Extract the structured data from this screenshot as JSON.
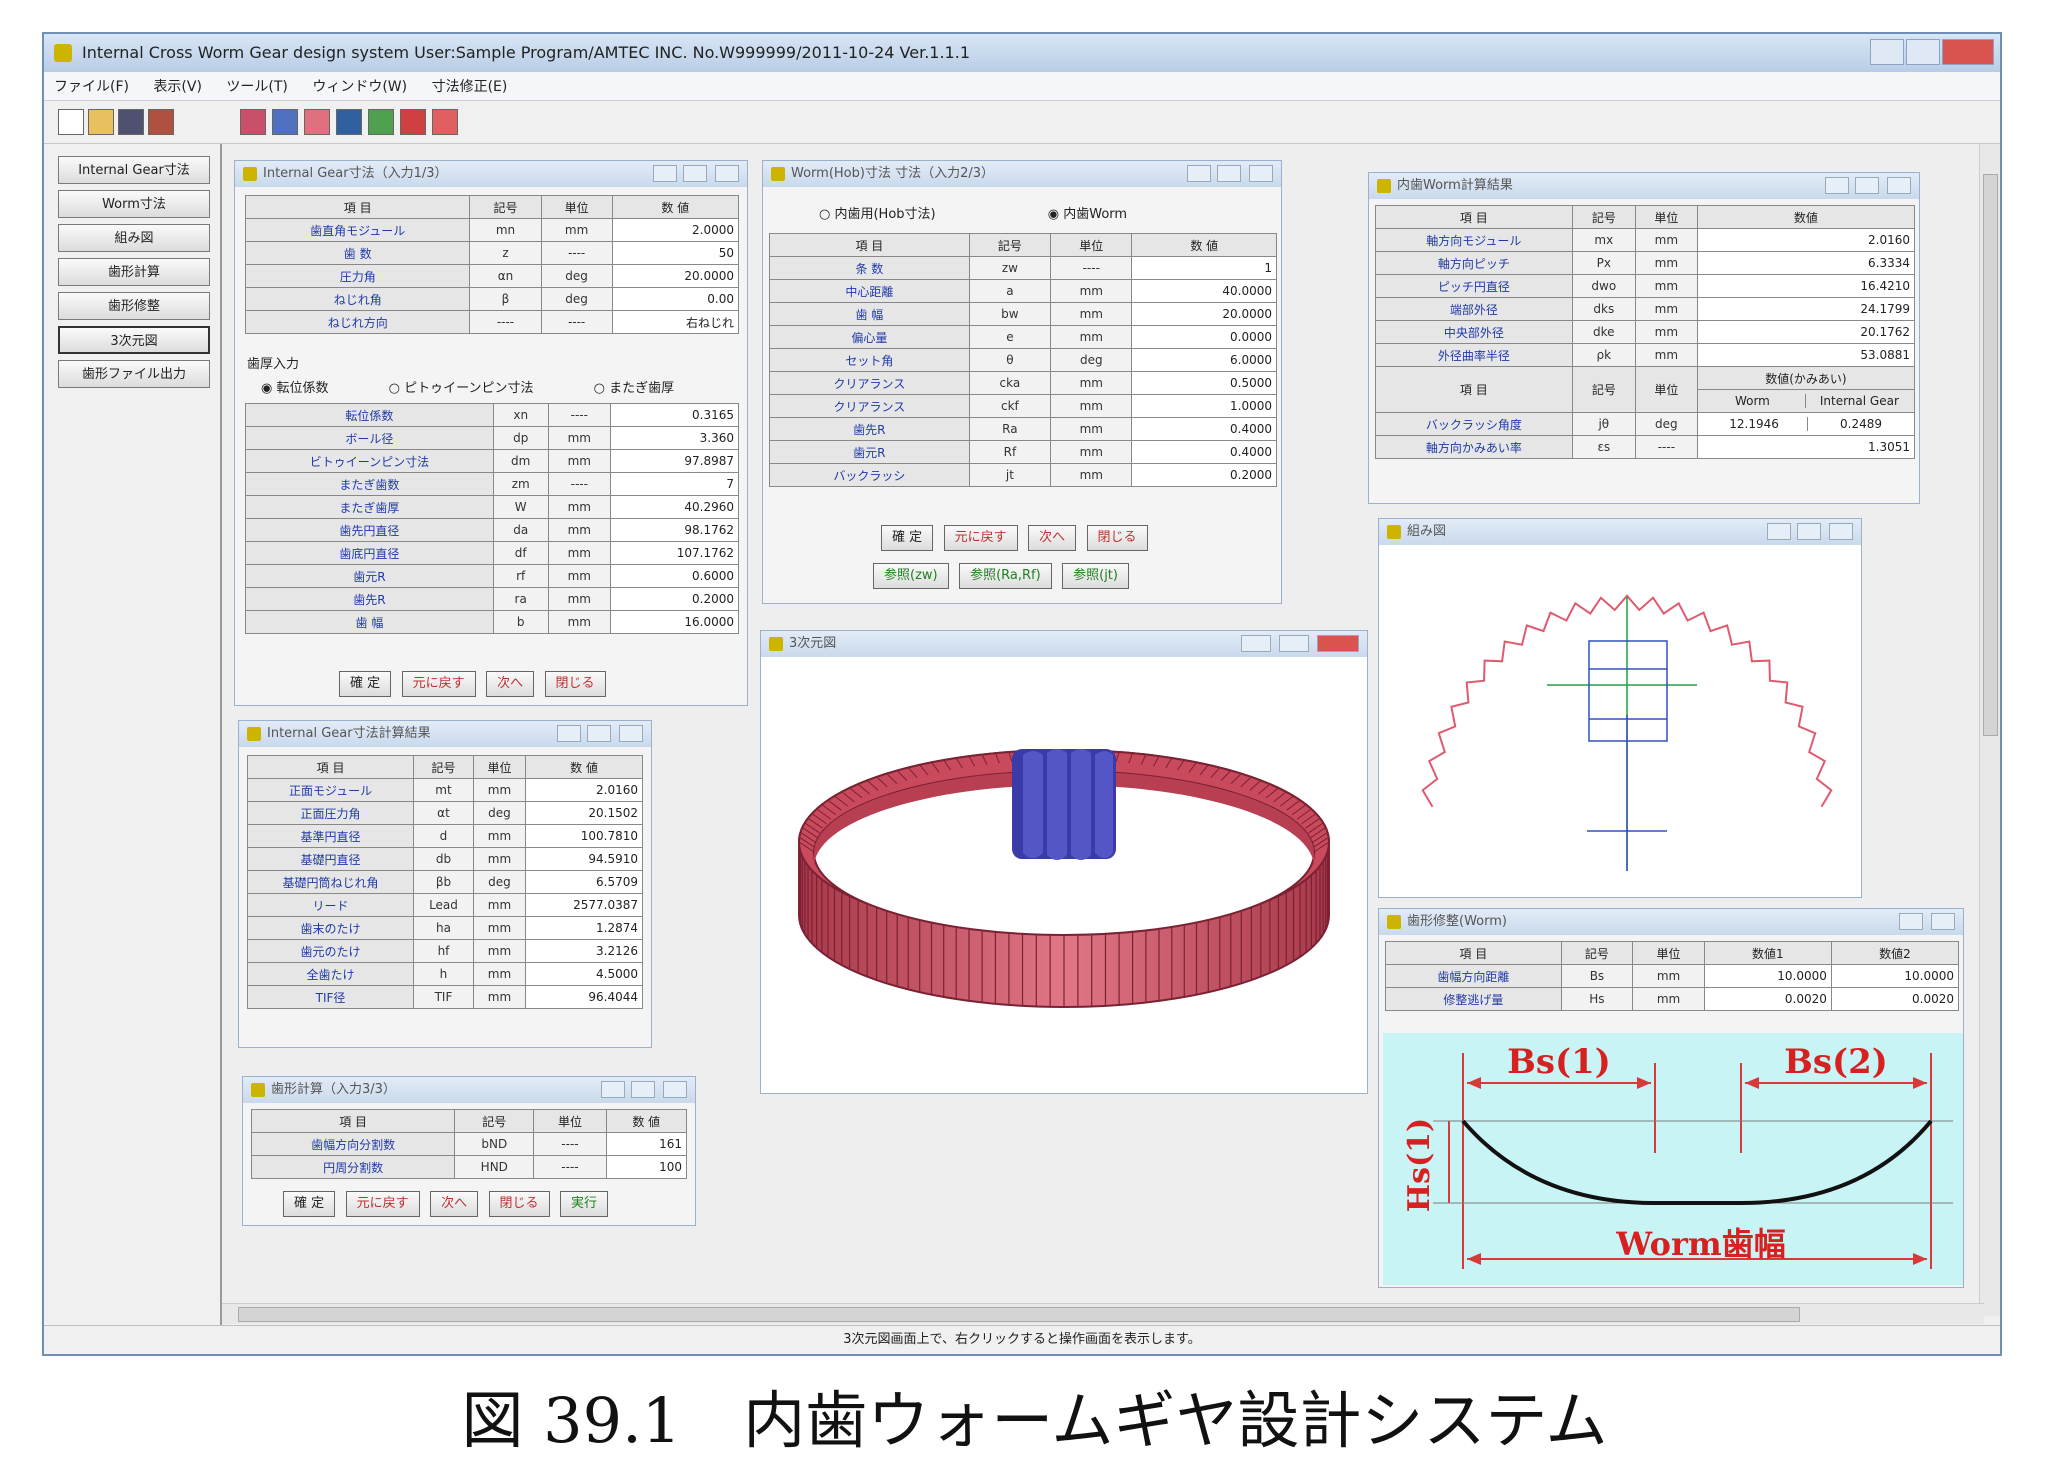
{
  "app": {
    "title": "Internal Cross Worm Gear design system   User:Sample Program/AMTEC INC.   No.W999999/2011-10-24   Ver.1.1.1",
    "menu": [
      "ファイル(F)",
      "表示(V)",
      "ツール(T)",
      "ウィンドウ(W)",
      "寸法修正(E)"
    ],
    "nav": [
      "Internal Gear寸法",
      "Worm寸法",
      "組み図",
      "歯形計算",
      "歯形修整",
      "3次元図",
      "歯形ファイル出力"
    ],
    "status": "3次元図画面上で、右クリックすると操作画面を表示します。"
  },
  "gear_input": {
    "title": "Internal Gear寸法（入力1/3）",
    "headers": [
      "項 目",
      "記号",
      "単位",
      "数 値"
    ],
    "rows": [
      {
        "label": "歯直角モジュール",
        "sym": "mn",
        "unit": "mm",
        "value": "2.0000"
      },
      {
        "label": "歯 数",
        "sym": "z",
        "unit": "----",
        "value": "50"
      },
      {
        "label": "圧力角",
        "sym": "αn",
        "unit": "deg",
        "value": "20.0000"
      },
      {
        "label": "ねじれ角",
        "sym": "β",
        "unit": "deg",
        "value": "0.00"
      },
      {
        "label": "ねじれ方向",
        "sym": "----",
        "unit": "----",
        "value": "右ねじれ"
      }
    ],
    "section": "歯厚入力",
    "radios": [
      "転位係数",
      "ピトゥイーンピン寸法",
      "またぎ歯厚"
    ],
    "rows2": [
      {
        "label": "転位係数",
        "sym": "xn",
        "unit": "----",
        "value": "0.3165"
      },
      {
        "label": "ボール径",
        "sym": "dp",
        "unit": "mm",
        "value": "3.360"
      },
      {
        "label": "ビトゥイーンピン寸法",
        "sym": "dm",
        "unit": "mm",
        "value": "97.8987"
      },
      {
        "label": "またぎ歯数",
        "sym": "zm",
        "unit": "----",
        "value": "7"
      },
      {
        "label": "またぎ歯厚",
        "sym": "W",
        "unit": "mm",
        "value": "40.2960"
      },
      {
        "label": "歯先円直径",
        "sym": "da",
        "unit": "mm",
        "value": "98.1762"
      },
      {
        "label": "歯底円直径",
        "sym": "df",
        "unit": "mm",
        "value": "107.1762"
      },
      {
        "label": "歯元R",
        "sym": "rf",
        "unit": "mm",
        "value": "0.6000"
      },
      {
        "label": "歯先R",
        "sym": "ra",
        "unit": "mm",
        "value": "0.2000"
      },
      {
        "label": "歯 幅",
        "sym": "b",
        "unit": "mm",
        "value": "16.0000"
      }
    ],
    "buttons": [
      "確 定",
      "元に戻す",
      "次へ",
      "閉じる"
    ]
  },
  "gear_result": {
    "title": "Internal Gear寸法計算結果",
    "headers": [
      "項 目",
      "記号",
      "単位",
      "数 値"
    ],
    "rows": [
      {
        "label": "正面モジュール",
        "sym": "mt",
        "unit": "mm",
        "value": "2.0160"
      },
      {
        "label": "正面圧力角",
        "sym": "αt",
        "unit": "deg",
        "value": "20.1502"
      },
      {
        "label": "基準円直径",
        "sym": "d",
        "unit": "mm",
        "value": "100.7810"
      },
      {
        "label": "基礎円直径",
        "sym": "db",
        "unit": "mm",
        "value": "94.5910"
      },
      {
        "label": "基礎円筒ねじれ角",
        "sym": "βb",
        "unit": "deg",
        "value": "6.5709"
      },
      {
        "label": "リード",
        "sym": "Lead",
        "unit": "mm",
        "value": "2577.0387"
      },
      {
        "label": "歯末のたけ",
        "sym": "ha",
        "unit": "mm",
        "value": "1.2874"
      },
      {
        "label": "歯元のたけ",
        "sym": "hf",
        "unit": "mm",
        "value": "3.2126"
      },
      {
        "label": "全歯たけ",
        "sym": "h",
        "unit": "mm",
        "value": "4.5000"
      },
      {
        "label": "TIF径",
        "sym": "TIF",
        "unit": "mm",
        "value": "96.4044"
      }
    ]
  },
  "tooth_calc": {
    "title": "歯形計算（入力3/3）",
    "headers": [
      "項 目",
      "記号",
      "単位",
      "数 値"
    ],
    "rows": [
      {
        "label": "歯幅方向分割数",
        "sym": "bND",
        "unit": "----",
        "value": "161"
      },
      {
        "label": "円周分割数",
        "sym": "HND",
        "unit": "----",
        "value": "100"
      }
    ],
    "buttons": [
      "確 定",
      "元に戻す",
      "次へ",
      "閉じる",
      "実行"
    ]
  },
  "worm_input": {
    "title": "Worm(Hob)寸法 寸法（入力2/3）",
    "radios": [
      "内歯用(Hob寸法)",
      "内歯Worm"
    ],
    "headers": [
      "項 目",
      "記号",
      "単位",
      "数 値"
    ],
    "rows": [
      {
        "label": "条 数",
        "sym": "zw",
        "unit": "----",
        "value": "1"
      },
      {
        "label": "中心距離",
        "sym": "a",
        "unit": "mm",
        "value": "40.0000"
      },
      {
        "label": "歯 幅",
        "sym": "bw",
        "unit": "mm",
        "value": "20.0000"
      },
      {
        "label": "偏心量",
        "sym": "e",
        "unit": "mm",
        "value": "0.0000"
      },
      {
        "label": "セット角",
        "sym": "θ",
        "unit": "deg",
        "value": "6.0000"
      },
      {
        "label": "クリアランス",
        "sym": "cka",
        "unit": "mm",
        "value": "0.5000"
      },
      {
        "label": "クリアランス",
        "sym": "ckf",
        "unit": "mm",
        "value": "1.0000"
      },
      {
        "label": "歯先R",
        "sym": "Ra",
        "unit": "mm",
        "value": "0.4000"
      },
      {
        "label": "歯元R",
        "sym": "Rf",
        "unit": "mm",
        "value": "0.4000"
      },
      {
        "label": "バックラッシ",
        "sym": "jt",
        "unit": "mm",
        "value": "0.2000"
      }
    ],
    "buttons": [
      "確 定",
      "元に戻す",
      "次へ",
      "閉じる"
    ],
    "buttons2": [
      "参照(zw)",
      "参照(Ra,Rf)",
      "参照(jt)"
    ]
  },
  "view3d": {
    "title": "3次元図"
  },
  "worm_result": {
    "title": "内歯Worm計算結果",
    "headers": [
      "項 目",
      "記号",
      "単位",
      "数値"
    ],
    "rows": [
      {
        "label": "軸方向モジュール",
        "sym": "mx",
        "unit": "mm",
        "value": "2.0160"
      },
      {
        "label": "軸方向ピッチ",
        "sym": "Px",
        "unit": "mm",
        "value": "6.3334"
      },
      {
        "label": "ピッチ円直径",
        "sym": "dwo",
        "unit": "mm",
        "value": "16.4210"
      },
      {
        "label": "端部外径",
        "sym": "dks",
        "unit": "mm",
        "value": "24.1799"
      },
      {
        "label": "中央部外径",
        "sym": "dke",
        "unit": "mm",
        "value": "20.1762"
      },
      {
        "label": "外径曲率半径",
        "sym": "ρk",
        "unit": "mm",
        "value": "53.0881"
      }
    ],
    "mesh_header": "数値(かみあい)",
    "mesh_cols": [
      "Worm",
      "Internal Gear"
    ],
    "mesh_rows": [
      {
        "label": "バックラッシ角度",
        "sym": "jθ",
        "unit": "deg",
        "worm": "12.1946",
        "gear": "0.2489"
      },
      {
        "label": "軸方向かみあい率",
        "sym": "εs",
        "unit": "----",
        "value": "1.3051"
      }
    ]
  },
  "assembly": {
    "title": "組み図"
  },
  "tooth_mod": {
    "title": "歯形修整(Worm)",
    "headers": [
      "項 目",
      "記号",
      "単位",
      "数値1",
      "数値2"
    ],
    "rows": [
      {
        "label": "歯幅方向距離",
        "sym": "Bs",
        "unit": "mm",
        "v1": "10.0000",
        "v2": "10.0000"
      },
      {
        "label": "修整逃げ量",
        "sym": "Hs",
        "unit": "mm",
        "v1": "0.0020",
        "v2": "0.0020"
      }
    ],
    "diagram": {
      "bs1": "Bs(1)",
      "bs2": "Bs(2)",
      "hs1": "Hs(1)",
      "width": "Worm歯幅"
    }
  },
  "caption": "図 39.1　内歯ウォームギヤ設計システム",
  "colors": {
    "gear": "#c9495d",
    "worm": "#4042b0",
    "accent": "#1f3aa8",
    "window_frame": "#6f8fb4"
  }
}
